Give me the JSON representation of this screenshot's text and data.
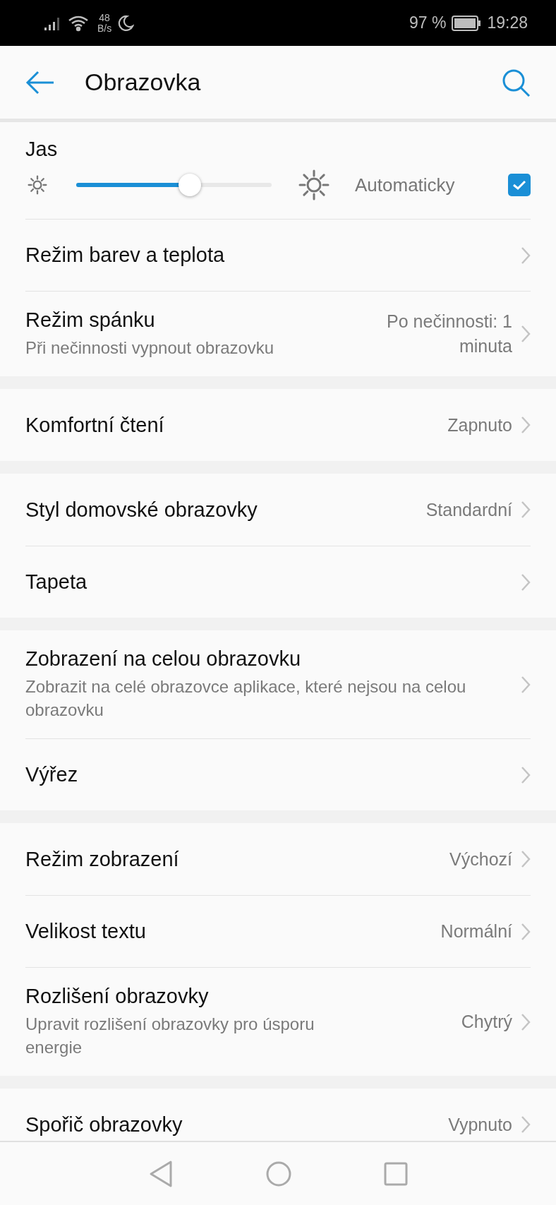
{
  "status_bar": {
    "speed_value": "48",
    "speed_unit": "B/s",
    "battery": "97 %",
    "time": "19:28"
  },
  "app_bar": {
    "title": "Obrazovka"
  },
  "sections": [
    {
      "items": [
        {
          "kind": "brightness",
          "title": "Jas",
          "level": 0.58,
          "auto_label": "Automaticky",
          "auto_checked": true
        },
        {
          "kind": "link",
          "title": "Režim barev a teplota"
        },
        {
          "kind": "link",
          "title": "Režim spánku",
          "subtitle": "Při nečinnosti vypnout obrazovku",
          "value": "Po nečinnosti: 1 minuta"
        }
      ]
    },
    {
      "items": [
        {
          "kind": "link",
          "title": "Komfortní čtení",
          "value": "Zapnuto"
        }
      ]
    },
    {
      "items": [
        {
          "kind": "link",
          "title": "Styl domovské obrazovky",
          "value": "Standardní"
        },
        {
          "kind": "link",
          "title": "Tapeta"
        }
      ]
    },
    {
      "items": [
        {
          "kind": "link",
          "title": "Zobrazení na celou obrazovku",
          "subtitle": "Zobrazit na celé obrazovce aplikace, které nejsou na celou obrazovku"
        },
        {
          "kind": "link",
          "title": "Výřez"
        }
      ]
    },
    {
      "items": [
        {
          "kind": "link",
          "title": "Režim zobrazení",
          "value": "Výchozí"
        },
        {
          "kind": "link",
          "title": "Velikost textu",
          "value": "Normální"
        },
        {
          "kind": "link",
          "title": "Rozlišení obrazovky",
          "subtitle": "Upravit rozlišení obrazovky pro úsporu energie",
          "value": "Chytrý"
        }
      ]
    },
    {
      "items": [
        {
          "kind": "link",
          "title": "Spořič obrazovky",
          "value": "Vypnuto"
        }
      ]
    }
  ]
}
